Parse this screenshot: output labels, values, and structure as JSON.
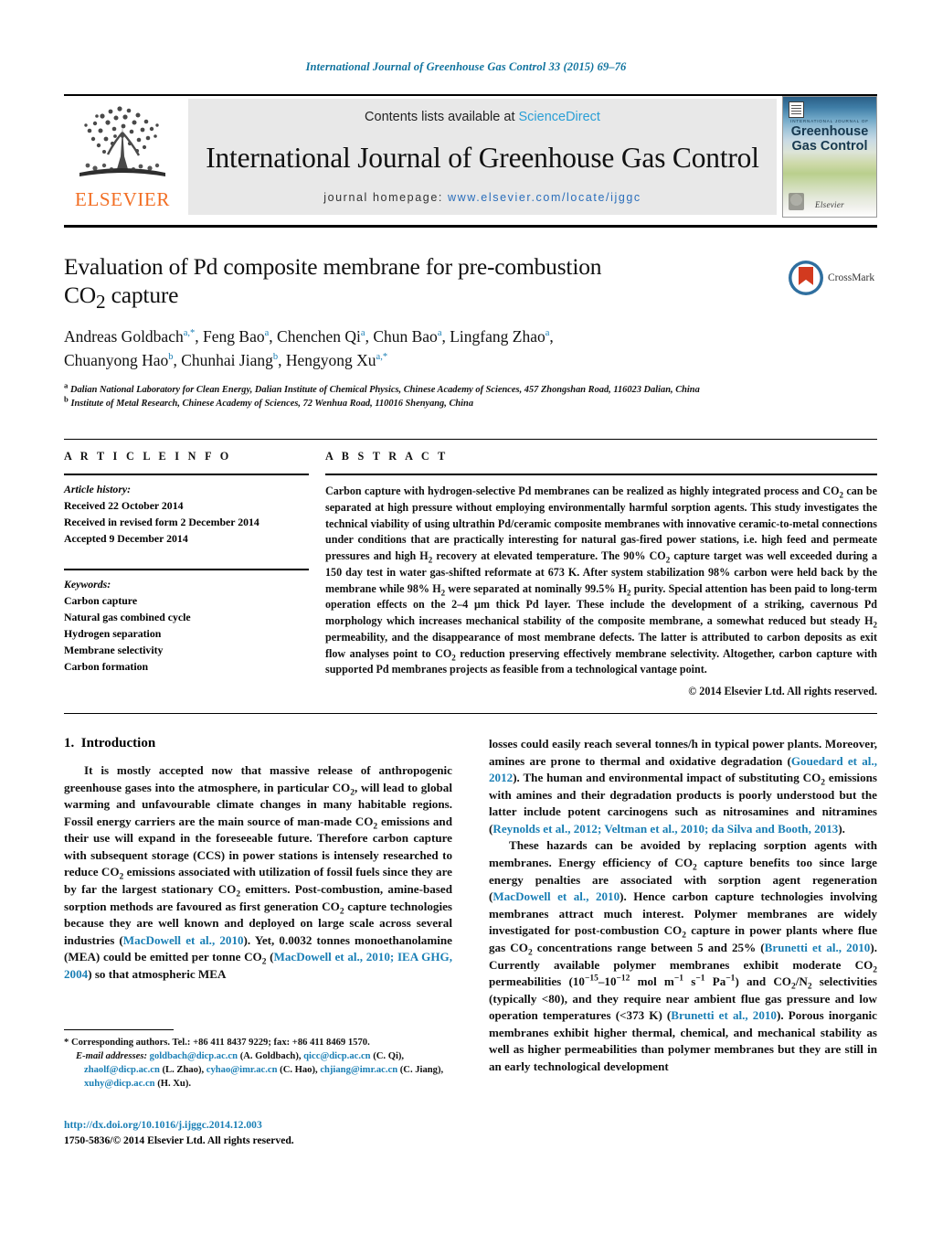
{
  "running_head": "International Journal of Greenhouse Gas Control 33 (2015) 69–76",
  "masthead": {
    "publisher_name": "ELSEVIER",
    "contents_prefix": "Contents lists available at ",
    "contents_link": "ScienceDirect",
    "journal_title": "International Journal of Greenhouse Gas Control",
    "homepage_prefix": "journal homepage: ",
    "homepage_url": "www.elsevier.com/locate/ijggc",
    "cover": {
      "kicker": "INTERNATIONAL JOURNAL OF",
      "name_line1": "Greenhouse",
      "name_line2": "Gas Control",
      "bottom_brand": "Elsevier"
    }
  },
  "title": {
    "line1": "Evaluation of Pd composite membrane for pre-combustion",
    "line2_pre": "CO",
    "line2_sub": "2",
    "line2_post": " capture"
  },
  "crossmark": {
    "label": "CrossMark"
  },
  "authors": [
    {
      "name": "Andreas Goldbach",
      "marks": "a,*"
    },
    {
      "name": "Feng Bao",
      "marks": "a"
    },
    {
      "name": "Chenchen Qi",
      "marks": "a"
    },
    {
      "name": "Chun Bao",
      "marks": "a"
    },
    {
      "name": "Lingfang Zhao",
      "marks": "a"
    },
    {
      "name": "Chuanyong Hao",
      "marks": "b"
    },
    {
      "name": "Chunhai Jiang",
      "marks": "b"
    },
    {
      "name": "Hengyong Xu",
      "marks": "a,*"
    }
  ],
  "affiliations": [
    {
      "mark": "a",
      "text": "Dalian National Laboratory for Clean Energy, Dalian Institute of Chemical Physics, Chinese Academy of Sciences, 457 Zhongshan Road, 116023 Dalian, China"
    },
    {
      "mark": "b",
      "text": "Institute of Metal Research, Chinese Academy of Sciences, 72 Wenhua Road, 110016 Shenyang, China"
    }
  ],
  "article_info": {
    "heading": "A R T I C L E   I N F O",
    "history_label": "Article history:",
    "history": [
      "Received 22 October 2014",
      "Received in revised form 2 December 2014",
      "Accepted 9 December 2014"
    ],
    "keywords_label": "Keywords:",
    "keywords": [
      "Carbon capture",
      "Natural gas combined cycle",
      "Hydrogen separation",
      "Membrane selectivity",
      "Carbon formation"
    ]
  },
  "abstract": {
    "heading": "A B S T R A C T",
    "text": "Carbon capture with hydrogen-selective Pd membranes can be realized as highly integrated process and CO2 can be separated at high pressure without employing environmentally harmful sorption agents. This study investigates the technical viability of using ultrathin Pd/ceramic composite membranes with innovative ceramic-to-metal connections under conditions that are practically interesting for natural gas-fired power stations, i.e. high feed and permeate pressures and high H2 recovery at elevated temperature. The 90% CO2 capture target was well exceeded during a 150 day test in water gas-shifted reformate at 673 K. After system stabilization 98% carbon were held back by the membrane while 98% H2 were separated at nominally 99.5% H2 purity. Special attention has been paid to long-term operation effects on the 2–4 μm thick Pd layer. These include the development of a striking, cavernous Pd morphology which increases mechanical stability of the composite membrane, a somewhat reduced but steady H2 permeability, and the disappearance of most membrane defects. The latter is attributed to carbon deposits as exit flow analyses point to CO2 reduction preserving effectively membrane selectivity. Altogether, carbon capture with supported Pd membranes projects as feasible from a technological vantage point.",
    "copyright": "© 2014 Elsevier Ltd. All rights reserved."
  },
  "introduction": {
    "section_number": "1.",
    "section_title": "Introduction",
    "left_paragraph_1": "It is mostly accepted now that massive release of anthropogenic greenhouse gases into the atmosphere, in particular CO2, will lead to global warming and unfavourable climate changes in many habitable regions. Fossil energy carriers are the main source of man-made CO2 emissions and their use will expand in the foreseeable future. Therefore carbon capture with subsequent storage (CCS) in power stations is intensely researched to reduce CO2 emissions associated with utilization of fossil fuels since they are by far the largest stationary CO2 emitters. Post-combustion, amine-based sorption methods are favoured as first generation CO2 capture technologies because they are well known and deployed on large scale across several industries (MacDowell et al., 2010). Yet, 0.0032 tonnes monoethanolamine (MEA) could be emitted per tonne CO2 (MacDowell et al., 2010; IEA GHG, 2004) so that atmospheric MEA",
    "right_paragraph_1": "losses could easily reach several tonnes/h in typical power plants. Moreover, amines are prone to thermal and oxidative degradation (Gouedard et al., 2012). The human and environmental impact of substituting CO2 emissions with amines and their degradation products is poorly understood but the latter include potent carcinogens such as nitrosamines and nitramines (Reynolds et al., 2012; Veltman et al., 2010; da Silva and Booth, 2013).",
    "right_paragraph_2": "These hazards can be avoided by replacing sorption agents with membranes. Energy efficiency of CO2 capture benefits too since large energy penalties are associated with sorption agent regeneration (MacDowell et al., 2010). Hence carbon capture technologies involving membranes attract much interest. Polymer membranes are widely investigated for post-combustion CO2 capture in power plants where flue gas CO2 concentrations range between 5 and 25% (Brunetti et al., 2010). Currently available polymer membranes exhibit moderate CO2 permeabilities (10−15–10−12 mol m−1 s−1 Pa−1) and CO2/N2 selectivities (typically <80), and they require near ambient flue gas pressure and low operation temperatures (<373 K) (Brunetti et al., 2010). Porous inorganic membranes exhibit higher thermal, chemical, and mechanical stability as well as higher permeabilities than polymer membranes but they are still in an early technological development"
  },
  "footnotes": {
    "corresponding": "* Corresponding authors. Tel.: +86 411 8437 9229; fax: +86 411 8469 1570.",
    "email_label": "E-mail addresses:",
    "emails": [
      {
        "address": "goldbach@dicp.ac.cn",
        "owner": "(A. Goldbach)"
      },
      {
        "address": "qicc@dicp.ac.cn",
        "owner": "(C. Qi)"
      },
      {
        "address": "zhaolf@dicp.ac.cn",
        "owner": "(L. Zhao)"
      },
      {
        "address": "cyhao@imr.ac.cn",
        "owner": "(C. Hao)"
      },
      {
        "address": "chjiang@imr.ac.cn",
        "owner": "(C. Jiang)"
      },
      {
        "address": "xuhy@dicp.ac.cn",
        "owner": "(H. Xu)"
      }
    ]
  },
  "doi_block": {
    "doi_url": "http://dx.doi.org/10.1016/j.ijggc.2014.12.003",
    "issn_line": "1750-5836/© 2014 Elsevier Ltd. All rights reserved."
  },
  "colors": {
    "link_blue": "#1a7fb5",
    "sciencedirect_blue": "#2a9fd6",
    "elsevier_orange": "#f26e23",
    "running_head_blue": "#10739e"
  }
}
